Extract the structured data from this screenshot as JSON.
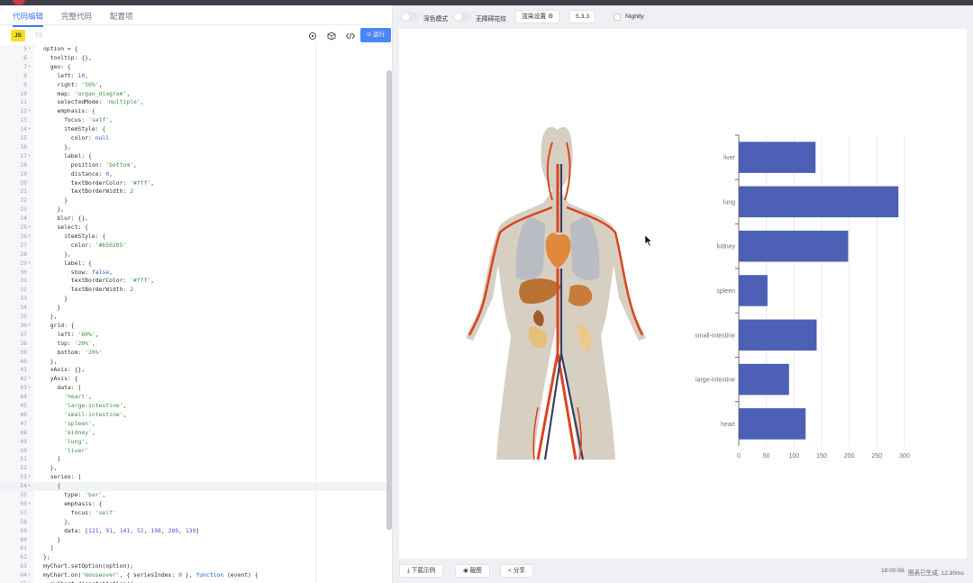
{
  "left_tabs": {
    "editor": "代码编辑",
    "full_code": "完整代码",
    "config": "配置项"
  },
  "toolbar": {
    "js": "JS",
    "ts": "TS",
    "run_label": "⊙ 运行"
  },
  "code_lines": [
    {
      "n": "5",
      "fold": true,
      "text": "option = {"
    },
    {
      "n": "6",
      "fold": false,
      "text": "  tooltip: {},"
    },
    {
      "n": "7",
      "fold": true,
      "text": "  geo: {"
    },
    {
      "n": "8",
      "fold": false,
      "text": "    left: 10,"
    },
    {
      "n": "9",
      "fold": false,
      "text": "    right: '50%',"
    },
    {
      "n": "10",
      "fold": false,
      "text": "    map: 'organ_diagram',"
    },
    {
      "n": "11",
      "fold": false,
      "text": "    selectedMode: 'multiple',"
    },
    {
      "n": "12",
      "fold": true,
      "text": "    emphasis: {"
    },
    {
      "n": "13",
      "fold": false,
      "text": "      focus: 'self',"
    },
    {
      "n": "14",
      "fold": true,
      "text": "      itemStyle: {"
    },
    {
      "n": "15",
      "fold": false,
      "text": "        color: null"
    },
    {
      "n": "16",
      "fold": false,
      "text": "      },"
    },
    {
      "n": "17",
      "fold": true,
      "text": "      label: {"
    },
    {
      "n": "18",
      "fold": false,
      "text": "        position: 'bottom',"
    },
    {
      "n": "19",
      "fold": false,
      "text": "        distance: 0,"
    },
    {
      "n": "20",
      "fold": false,
      "text": "        textBorderColor: '#fff',"
    },
    {
      "n": "21",
      "fold": false,
      "text": "        textBorderWidth: 2"
    },
    {
      "n": "22",
      "fold": false,
      "text": "      }"
    },
    {
      "n": "23",
      "fold": false,
      "text": "    },"
    },
    {
      "n": "24",
      "fold": false,
      "text": "    blur: {},"
    },
    {
      "n": "25",
      "fold": true,
      "text": "    select: {"
    },
    {
      "n": "26",
      "fold": true,
      "text": "      itemStyle: {"
    },
    {
      "n": "27",
      "fold": false,
      "text": "        color: '#b50205'"
    },
    {
      "n": "28",
      "fold": false,
      "text": "      },"
    },
    {
      "n": "29",
      "fold": true,
      "text": "      label: {"
    },
    {
      "n": "30",
      "fold": false,
      "text": "        show: false,"
    },
    {
      "n": "31",
      "fold": false,
      "text": "        textBorderColor: '#fff',"
    },
    {
      "n": "32",
      "fold": false,
      "text": "        textBorderWidth: 2"
    },
    {
      "n": "33",
      "fold": false,
      "text": "      }"
    },
    {
      "n": "34",
      "fold": false,
      "text": "    }"
    },
    {
      "n": "35",
      "fold": false,
      "text": "  },"
    },
    {
      "n": "36",
      "fold": true,
      "text": "  grid: {"
    },
    {
      "n": "37",
      "fold": false,
      "text": "    left: '60%',"
    },
    {
      "n": "38",
      "fold": false,
      "text": "    top: '20%',"
    },
    {
      "n": "39",
      "fold": false,
      "text": "    bottom: '20%'"
    },
    {
      "n": "40",
      "fold": false,
      "text": "  },"
    },
    {
      "n": "41",
      "fold": false,
      "text": "  xAxis: {},"
    },
    {
      "n": "42",
      "fold": true,
      "text": "  yAxis: {"
    },
    {
      "n": "43",
      "fold": true,
      "text": "    data: ["
    },
    {
      "n": "44",
      "fold": false,
      "text": "      'heart',"
    },
    {
      "n": "45",
      "fold": false,
      "text": "      'large-intestine',"
    },
    {
      "n": "46",
      "fold": false,
      "text": "      'small-intestine',"
    },
    {
      "n": "47",
      "fold": false,
      "text": "      'spleen',"
    },
    {
      "n": "48",
      "fold": false,
      "text": "      'kidney',"
    },
    {
      "n": "49",
      "fold": false,
      "text": "      'lung',"
    },
    {
      "n": "50",
      "fold": false,
      "text": "      'liver'"
    },
    {
      "n": "51",
      "fold": false,
      "text": "    ]"
    },
    {
      "n": "52",
      "fold": false,
      "text": "  },"
    },
    {
      "n": "53",
      "fold": true,
      "text": "  series: ["
    },
    {
      "n": "54",
      "fold": true,
      "text": "    {"
    },
    {
      "n": "55",
      "fold": false,
      "text": "      type: 'bar',"
    },
    {
      "n": "56",
      "fold": true,
      "text": "      emphasis: {"
    },
    {
      "n": "57",
      "fold": false,
      "text": "        focus: 'self'"
    },
    {
      "n": "58",
      "fold": false,
      "text": "      },"
    },
    {
      "n": "59",
      "fold": false,
      "text": "      data: [121, 91, 141, 52, 198, 289, 139]"
    },
    {
      "n": "60",
      "fold": false,
      "text": "    }"
    },
    {
      "n": "61",
      "fold": false,
      "text": "  ]"
    },
    {
      "n": "62",
      "fold": false,
      "text": "};"
    },
    {
      "n": "63",
      "fold": false,
      "text": "myChart.setOption(option);"
    },
    {
      "n": "64",
      "fold": true,
      "text": "myChart.on('mouseover', { seriesIndex: 0 }, function (event) {"
    },
    {
      "n": "65",
      "fold": true,
      "text": "  myChart.dispatchAction({"
    }
  ],
  "current_line": "54",
  "right_toolbar": {
    "dark_mode": "深色模式",
    "no_pattern": "无障碍花纹",
    "render_settings": "渲染设置 ⚙",
    "version": "5.3.3",
    "nightly": "Nightly"
  },
  "bottom_bar": {
    "download": "下载示例",
    "screenshot": "截图",
    "share": "分享",
    "time": "18:00:56",
    "status": "图表已生成, 12.90ms"
  },
  "colors": {
    "bar": "#4c60b5",
    "accent": "#3f7cf6"
  },
  "chart_data": {
    "type": "bar",
    "orientation": "horizontal",
    "categories": [
      "heart",
      "large-intestine",
      "small-intestine",
      "spleen",
      "kidney",
      "lung",
      "liver"
    ],
    "values": [
      121,
      91,
      141,
      52,
      198,
      289,
      139
    ],
    "xlim": [
      0,
      300
    ],
    "xticks": [
      0,
      50,
      100,
      150,
      200,
      250,
      300
    ],
    "grid": "vertical"
  }
}
